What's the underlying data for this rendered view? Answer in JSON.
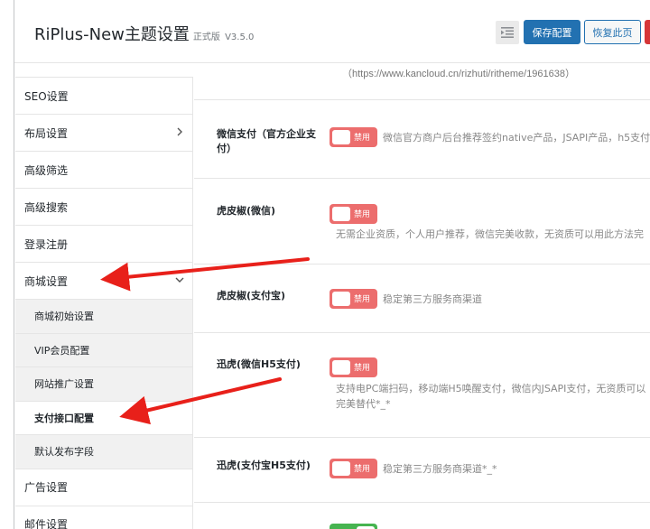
{
  "header": {
    "title": "RiPlus-New主题设置",
    "edition": "正式版",
    "version": "V3.5.0",
    "save_label": "保存配置",
    "restore_label": "恢复此页"
  },
  "sidebar": {
    "items": [
      {
        "label": "SEO设置"
      },
      {
        "label": "布局设置",
        "icon": "chevron-right-icon"
      },
      {
        "label": "高级筛选"
      },
      {
        "label": "高级搜索"
      },
      {
        "label": "登录注册"
      },
      {
        "label": "商城设置",
        "icon": "chevron-down-icon"
      }
    ],
    "shop_sub": [
      {
        "label": "商城初始设置"
      },
      {
        "label": "VIP会员配置"
      },
      {
        "label": "网站推广设置"
      },
      {
        "label": "支付接口配置",
        "active": true
      },
      {
        "label": "默认发布字段"
      }
    ],
    "after": [
      {
        "label": "广告设置"
      },
      {
        "label": "邮件设置"
      }
    ]
  },
  "content": {
    "top_note": "（https://www.kancloud.cn/rizhuti/ritheme/1961638）",
    "rows": [
      {
        "label": "微信支付（官方企业支付）",
        "toggle": "禁用",
        "desc": "微信官方商户后台推荐签约native产品，JSAPI产品，h5支付"
      },
      {
        "label": "虎皮椒(微信)",
        "toggle": "禁用",
        "desc": "无需企业资质，个人用户推荐，微信完美收款，无资质可以用此方法完"
      },
      {
        "label": "虎皮椒(支付宝)",
        "toggle": "禁用",
        "desc": "稳定第三方服务商渠道"
      },
      {
        "label": "迅虎(微信H5支付)",
        "toggle": "禁用",
        "desc_line1": "支持电PC端扫码，移动端H5唤醒支付，微信内JSAPI支付，无资质可以",
        "desc_line2": "完美替代*_*"
      },
      {
        "label": "迅虎(支付宝H5支付)",
        "toggle": "禁用",
        "desc": "稳定第三方服务商渠道*_*"
      }
    ]
  },
  "colors": {
    "primary": "#2271b1",
    "toggle_off": "#ec6d6d",
    "toggle_on": "#46b450",
    "arrow": "#e8201a"
  }
}
